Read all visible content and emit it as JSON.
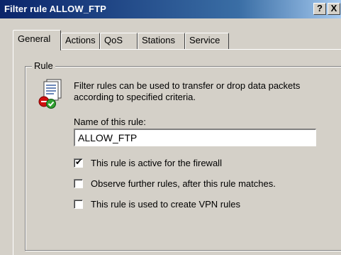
{
  "window": {
    "title": "Filter rule ALLOW_FTP",
    "help_button": "?",
    "close_button": "X"
  },
  "tabs": [
    {
      "label": "General",
      "active": true
    },
    {
      "label": "Actions",
      "active": false
    },
    {
      "label": "QoS",
      "active": false
    },
    {
      "label": "Stations",
      "active": false
    },
    {
      "label": "Service",
      "active": false
    }
  ],
  "rule_group": {
    "legend": "Rule",
    "icon": "filter-rule-document-icon",
    "description": "Filter rules can be used to transfer or drop data packets according to specified criteria.",
    "name_label": "Name of this rule:",
    "name_value": "ALLOW_FTP",
    "checkboxes": [
      {
        "label": "This rule is active for the firewall",
        "checked": true
      },
      {
        "label": "Observe further rules, after this rule matches.",
        "checked": false
      },
      {
        "label": "This rule is used to create VPN rules",
        "checked": false
      }
    ]
  },
  "colors": {
    "titlebar_start": "#0a246a",
    "titlebar_end": "#a6caf0",
    "dialog_bg": "#d4d0c8"
  }
}
